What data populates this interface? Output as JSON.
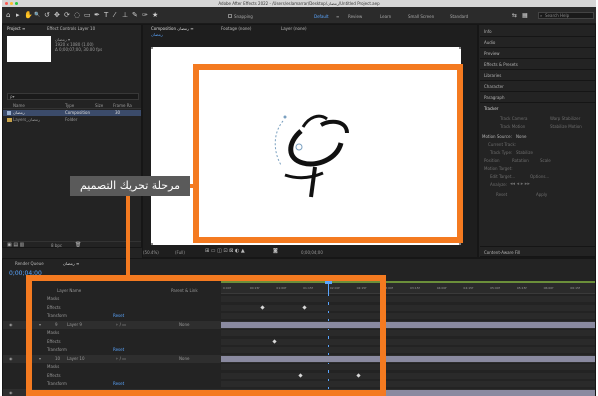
{
  "window": {
    "title": "Adobe After Effects 2022 - /Users/eslamarrar/Desktop/رمضان/Untitled Project.aep"
  },
  "toolbar": {
    "tools": [
      "⌂",
      "▸",
      "✋",
      "🔍",
      "↺",
      "✥",
      "⟳",
      "◌",
      "▭",
      "✒",
      "T",
      "⁄",
      "⊥",
      "✎",
      "✑",
      "★"
    ],
    "snapping_label": "Snapping",
    "workspaces": [
      "Default",
      "≡",
      "Review",
      "Learn",
      "Small Screen",
      "Standard"
    ],
    "active_workspace": "Default",
    "search_placeholder": "Search Help"
  },
  "project_panel": {
    "tab_project": "Project ≡",
    "tab_effect": "Effect Controls Layer 10",
    "comp_info": [
      "رمضان ▾",
      "1920 x 1080 (1.00)",
      "Δ 0;00;07;00, 30.00 fps"
    ],
    "search_placeholder": "ρ▾",
    "columns": [
      "Name",
      "Type",
      "Size",
      "Frame Ra"
    ],
    "items": [
      {
        "name": "رمضان",
        "type": "Composition",
        "rate": "30"
      },
      {
        "name": "Layers_رمضان",
        "type": "Folder",
        "rate": ""
      }
    ],
    "bottom_label": "8 bpc"
  },
  "comp_panel": {
    "tab_comp": "Composition رمضان ≡",
    "tab_footage": "Footage (none)",
    "tab_layer": "Layer (none)",
    "breadcrumb": "رمضان",
    "zoom": "(50.4%)",
    "quality": "(Full)",
    "timecode": "0;00;04;00"
  },
  "right_panel": {
    "items": [
      "Info",
      "Audio",
      "Preview",
      "Effects & Presets",
      "Libraries",
      "Character",
      "Paragraph",
      "Tracker"
    ],
    "tracker_buttons": [
      "Track Camera",
      "Warp Stabilizer",
      "Track Motion",
      "Stabilize Motion"
    ],
    "motion_source_label": "Motion Source:",
    "motion_source_value": "None",
    "current_track": "Current Track:",
    "track_type": "Track Type:",
    "track_type_value": "Stabilize",
    "checkboxes": [
      "Position",
      "Rotation",
      "Scale"
    ],
    "motion_target": "Motion Target:",
    "edit_target": "Edit Target...",
    "options": "Options...",
    "analyze": "Analyze:",
    "reset": "Reset",
    "apply": "Apply",
    "content_aware_fill": "Content-Aware Fill"
  },
  "timeline": {
    "tab_render": "Render Queue",
    "tab_comp": "رمضان ≡",
    "timecode": "0;00;04;00",
    "columns": [
      "Layer Name",
      "Parent & Link"
    ],
    "time_ticks": [
      "0:00f",
      "00:15f",
      "01:00f",
      "01:15f",
      "02:00f",
      "02:15f",
      "03:00f",
      "03:15f",
      "04:00f",
      "04:15f",
      "05:00f",
      "05:15f",
      "06:00f",
      "06:15f"
    ],
    "rows": [
      {
        "kind": "prop",
        "label": "Masks"
      },
      {
        "kind": "prop",
        "label": "Effects"
      },
      {
        "kind": "prop",
        "label": "Transform",
        "extra": "Reset"
      },
      {
        "kind": "layer",
        "num": "9",
        "label": "Layer 9",
        "parent": "None"
      },
      {
        "kind": "prop",
        "label": "Masks"
      },
      {
        "kind": "prop",
        "label": "Effects"
      },
      {
        "kind": "prop",
        "label": "Transform",
        "extra": "Reset"
      },
      {
        "kind": "layer",
        "num": "10",
        "label": "Layer 10",
        "parent": "None"
      },
      {
        "kind": "prop",
        "label": "Masks"
      },
      {
        "kind": "prop",
        "label": "Effects"
      },
      {
        "kind": "prop",
        "label": "Transform",
        "extra": "Reset"
      },
      {
        "kind": "layer",
        "num": "11",
        "label": "Layer 11",
        "parent": "None"
      }
    ]
  },
  "callout": {
    "text": "مرحلة تحريك التصميم"
  },
  "colors": {
    "accent_orange": "#f47a20",
    "selection_blue": "#5aa6ff",
    "layer_bar": "#8a8aa0"
  }
}
